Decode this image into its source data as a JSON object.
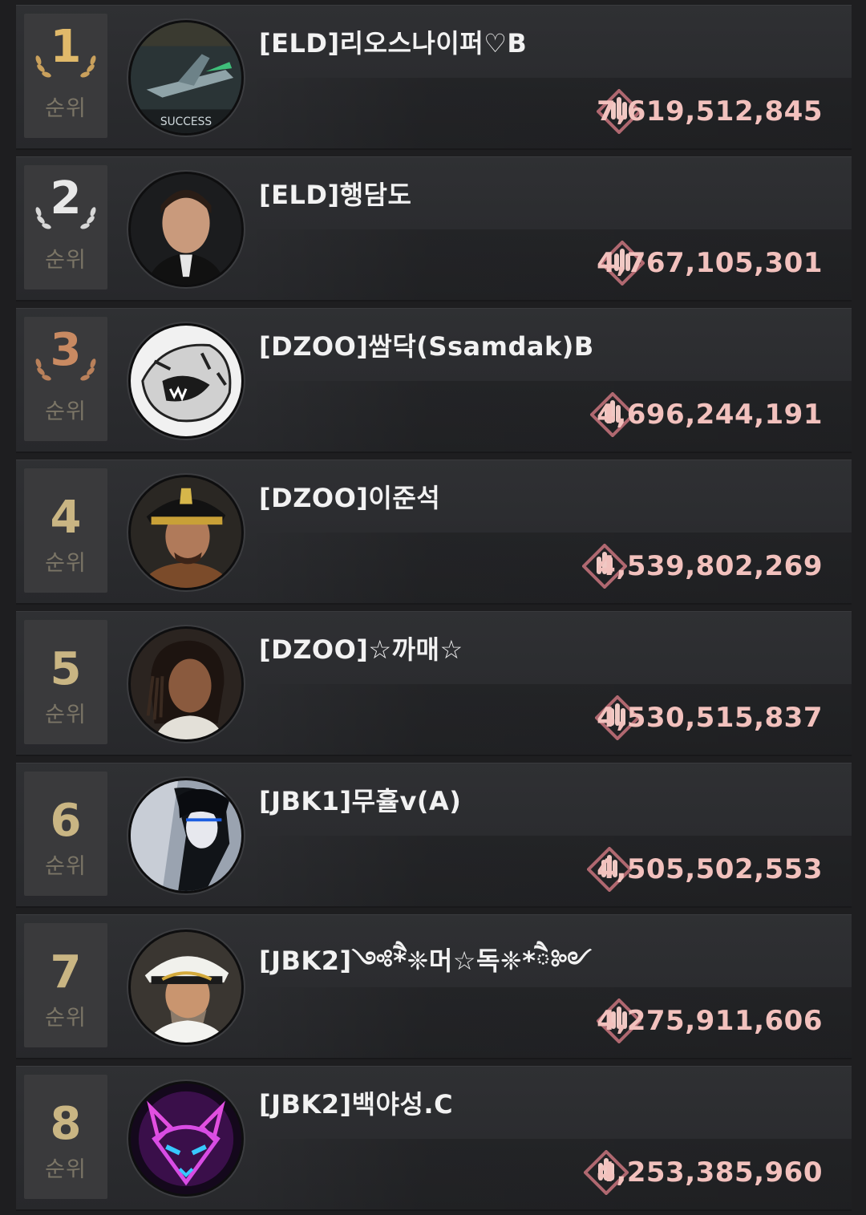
{
  "rank_label": "순위",
  "colors": {
    "score_text": "#f2c1bd",
    "rank_gold": "#e0b96a",
    "rank_silver": "#e8e8e8",
    "rank_bronze": "#c98a62",
    "rank_default": "#c9b583"
  },
  "rows": [
    {
      "rank": "1",
      "medal": "gold",
      "name": "[ELD]리오스나이퍼♡B",
      "score": "7,619,512,845",
      "avatar": "jet-avatar"
    },
    {
      "rank": "2",
      "medal": "silver",
      "name": "[ELD]행담도",
      "score": "4,767,105,301",
      "avatar": "man-suit-avatar"
    },
    {
      "rank": "3",
      "medal": "bronze",
      "name": "[DZOO]쌈닥(Ssamdak)B",
      "score": "4,696,244,191",
      "avatar": "tiger-sketch-avatar"
    },
    {
      "rank": "4",
      "medal": "none",
      "name": "[DZOO]이준석",
      "score": "4,539,802,269",
      "avatar": "captain-avatar"
    },
    {
      "rank": "5",
      "medal": "none",
      "name": "[DZOO]☆까매☆",
      "score": "4,530,515,837",
      "avatar": "woman-braids-avatar"
    },
    {
      "rank": "6",
      "medal": "none",
      "name": "[JBK1]무휼v(A)",
      "score": "4,505,502,553",
      "avatar": "anime-warrior-avatar"
    },
    {
      "rank": "7",
      "medal": "none",
      "name": "[JBK2]༺ཻ*❈머☆독❈*ཻ༻",
      "score": "4,275,911,606",
      "avatar": "admiral-avatar"
    },
    {
      "rank": "8",
      "medal": "none",
      "name": "[JBK2]백야성.C",
      "score": "4,253,385,960",
      "avatar": "neon-fox-avatar"
    }
  ],
  "icons": {
    "power": "missile-power-icon",
    "laurel": "laurel-wreath-icon"
  }
}
